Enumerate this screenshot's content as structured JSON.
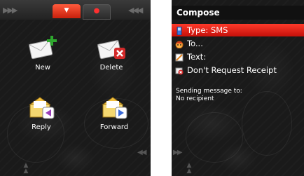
{
  "left": {
    "tiles": [
      {
        "label": "New",
        "icon": "new-message-icon",
        "badge": "+",
        "badge_color": "#2ea82e"
      },
      {
        "label": "Delete",
        "icon": "delete-message-icon",
        "badge": "✕",
        "badge_color": "#d22a2a"
      },
      {
        "label": "Reply",
        "icon": "reply-message-icon",
        "badge": "◀",
        "badge_color": "#9a3fb8"
      },
      {
        "label": "Forward",
        "icon": "forward-message-icon",
        "badge": "▶",
        "badge_color": "#3a6ad8"
      }
    ]
  },
  "right": {
    "title": "Compose",
    "menu": [
      {
        "label": "Type: SMS",
        "icon": "phone-icon",
        "selected": true
      },
      {
        "label": "To...",
        "icon": "contact-face-icon",
        "selected": false
      },
      {
        "label": "Text:",
        "icon": "text-note-icon",
        "selected": false
      },
      {
        "label": "Don't Request Receipt",
        "icon": "no-receipt-icon",
        "selected": false
      }
    ],
    "status_line1": "Sending message to:",
    "status_line2": "No recipient"
  },
  "colors": {
    "accent": "#e0281a",
    "background": "#1a1a1a"
  }
}
